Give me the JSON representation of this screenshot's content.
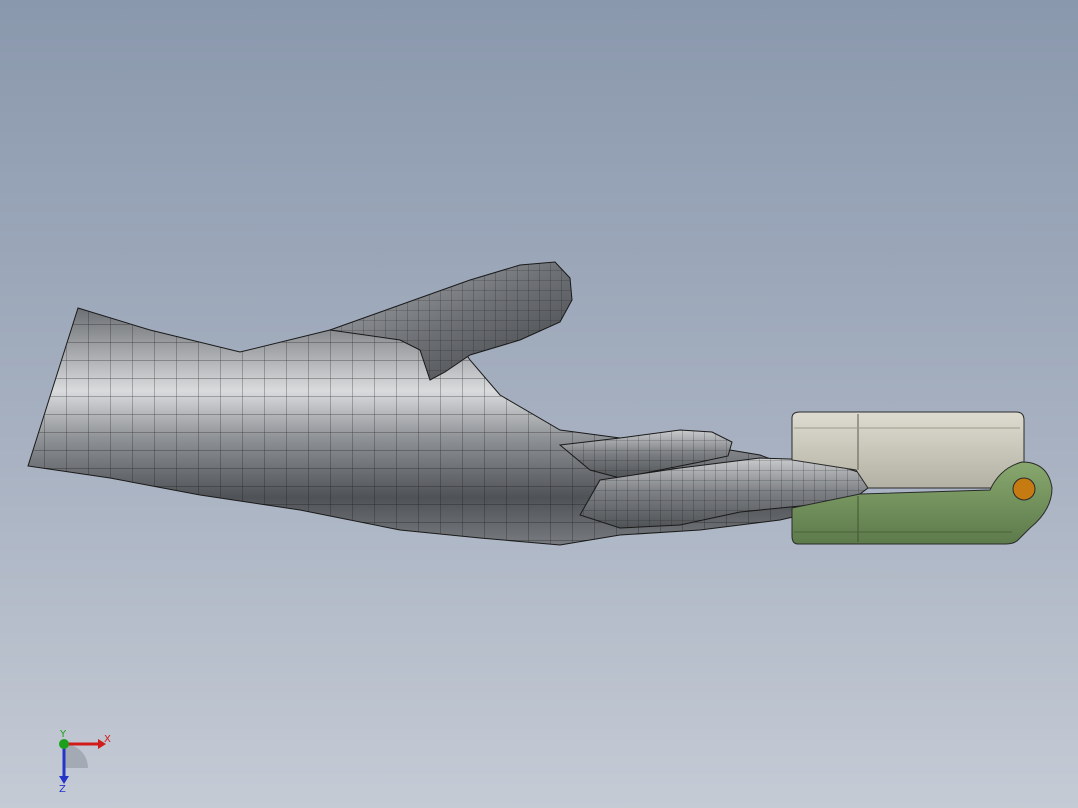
{
  "viewport": {
    "background_top": "#8a98ad",
    "background_bottom": "#c5cbd5"
  },
  "model": {
    "hand_color": "#8f9296",
    "device_top_color": "#c8c6b8",
    "device_bottom_color": "#6f8f5a",
    "pin_color": "#c57a12"
  },
  "triad": {
    "x_label": "X",
    "y_label": "Y",
    "z_label": "Z",
    "x_color": "#d11a1a",
    "y_color": "#1aa01a",
    "z_color": "#2433c8"
  }
}
